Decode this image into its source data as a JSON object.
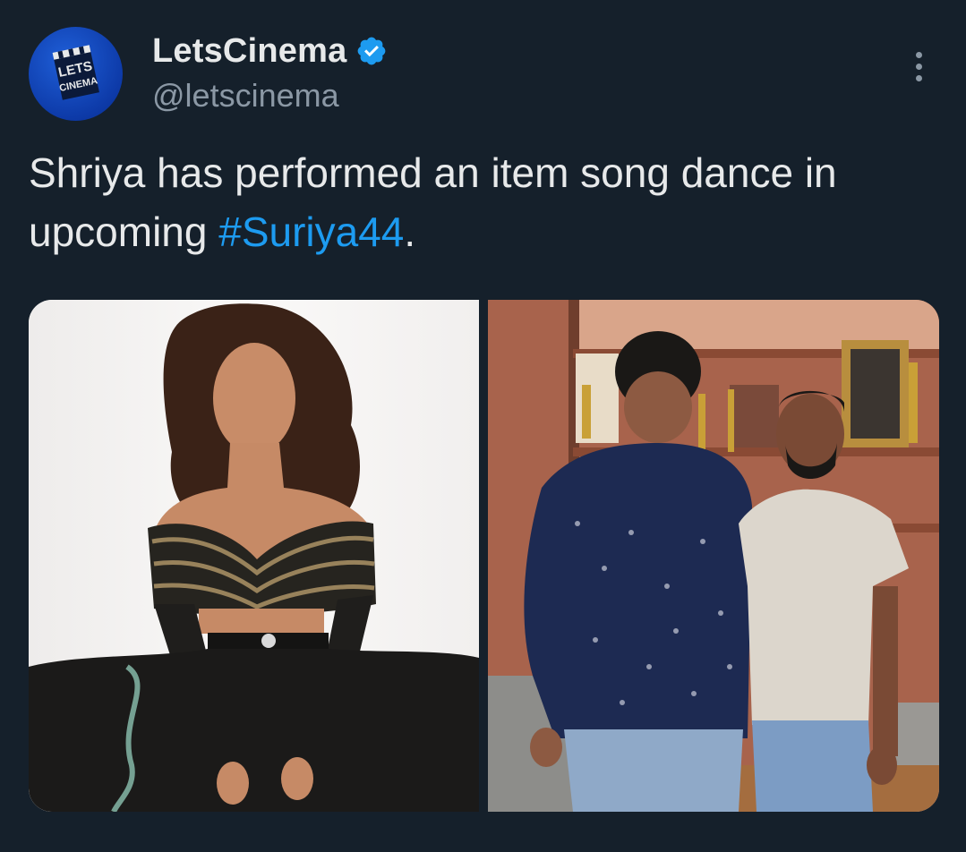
{
  "tweet": {
    "author": {
      "display_name": "LetsCinema",
      "handle": "@letscinema",
      "verified": true,
      "avatar_text": [
        "LETS",
        "CINEMA"
      ]
    },
    "text_before": "Shriya has performed an item song dance in upcoming ",
    "hashtag": "#Suriya44",
    "text_after": ".",
    "colors": {
      "background": "#15202b",
      "link": "#1d9bf0",
      "verified": "#1d9bf0",
      "muted": "#8b98a5"
    },
    "icons": {
      "verified": "verified-badge-icon",
      "more": "more-options-icon"
    },
    "media": [
      {
        "name": "photo-left",
        "alt": "Woman in black embellished outfit posing on white background"
      },
      {
        "name": "photo-right",
        "alt": "Two men standing in a room with award shelves"
      }
    ]
  }
}
